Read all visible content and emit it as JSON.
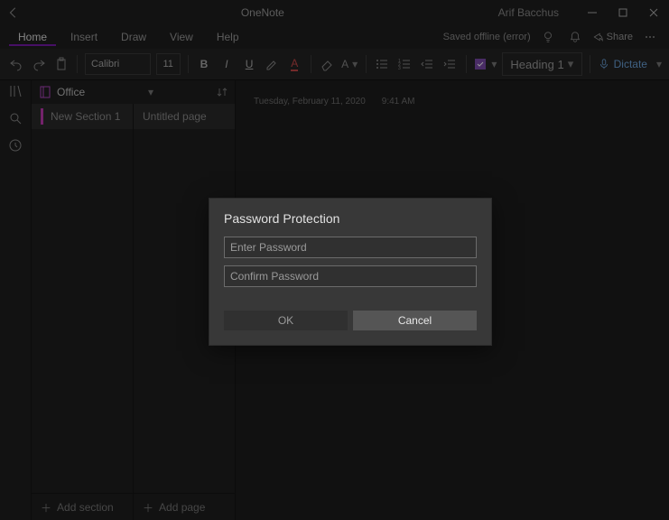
{
  "titlebar": {
    "app_name": "OneNote",
    "user_name": "Arif Bacchus"
  },
  "menubar": {
    "items": [
      "Home",
      "Insert",
      "Draw",
      "View",
      "Help"
    ],
    "active_index": 0,
    "status_text": "Saved offline (error)",
    "share_label": "Share"
  },
  "toolbar": {
    "font_name": "Calibri",
    "font_size": "11",
    "style_label": "Heading 1",
    "dictate_label": "Dictate"
  },
  "notebook": {
    "name": "Office",
    "sections": [
      {
        "label": "New Section 1",
        "selected": true
      }
    ],
    "pages": [
      {
        "label": "Untitled page",
        "selected": true
      }
    ],
    "add_section_label": "Add section",
    "add_page_label": "Add page"
  },
  "page": {
    "date": "Tuesday, February 11, 2020",
    "time": "9:41 AM"
  },
  "dialog": {
    "title": "Password Protection",
    "enter_placeholder": "Enter Password",
    "confirm_placeholder": "Confirm Password",
    "ok_label": "OK",
    "cancel_label": "Cancel"
  }
}
